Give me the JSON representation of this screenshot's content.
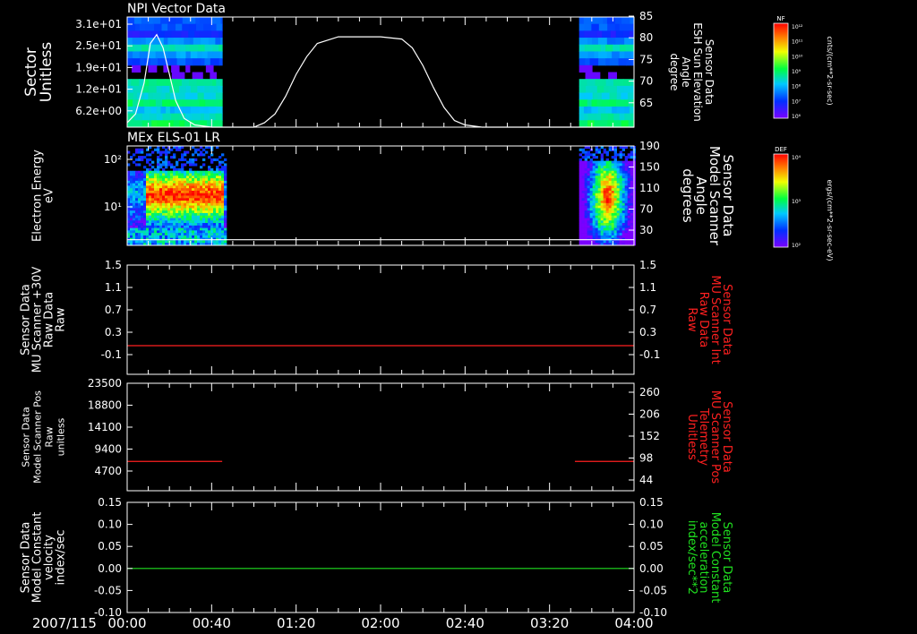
{
  "date_label": "2007/115",
  "time_ticks": [
    "00:00",
    "00:40",
    "01:20",
    "02:00",
    "02:40",
    "03:20",
    "04:00"
  ],
  "colorbars": [
    {
      "title": "NF",
      "unit": "cnts/(cm**2-sr-sec)",
      "ticks": [
        "10¹²",
        "10¹¹",
        "10¹⁰",
        "10⁹",
        "10⁸",
        "10⁷",
        "10⁶"
      ]
    },
    {
      "title": "DEF",
      "unit": "ergs/(cm**2-sr-sec-eV)",
      "ticks": [
        "10⁴",
        "10³",
        "10²"
      ]
    }
  ],
  "chart_data": [
    {
      "type": "heatmap",
      "title": "NPI Vector Data",
      "ylabel": [
        "Sector",
        "Unitless"
      ],
      "y_ticks": [
        "3.1e+01",
        "2.5e+01",
        "1.9e+01",
        "1.2e+01",
        "6.2e+00"
      ],
      "x_range": [
        "00:00",
        "04:00"
      ],
      "data_intervals": [
        [
          "00:00",
          "00:45"
        ],
        [
          "03:34",
          "04:00"
        ]
      ],
      "right_axis": {
        "label": [
          "Sensor Data",
          "ESH Sun Elevation",
          "Angle",
          "degree"
        ],
        "ticks": [
          85,
          80,
          75,
          70,
          65
        ],
        "ylim": [
          60,
          85
        ],
        "color": "#ffffff"
      },
      "overlay_line": {
        "name": "ESH Sun Elevation Angle",
        "x": [
          "00:00",
          "00:04",
          "00:08",
          "00:11",
          "00:14",
          "00:17",
          "00:20",
          "00:23",
          "00:27",
          "00:32",
          "00:40",
          "01:00",
          "01:05",
          "01:10",
          "01:15",
          "01:20",
          "01:25",
          "01:30",
          "01:40",
          "01:50",
          "02:00",
          "02:10",
          "02:15",
          "02:20",
          "02:25",
          "02:30",
          "02:35",
          "02:40",
          "02:48",
          "04:00"
        ],
        "y": [
          61,
          63,
          70,
          79,
          81,
          78,
          72,
          66,
          62,
          60.5,
          60,
          60,
          61,
          63,
          67,
          72,
          76,
          79,
          80.5,
          80.5,
          80.5,
          80,
          78,
          74,
          69,
          64.5,
          61.5,
          60.5,
          60,
          60
        ]
      }
    },
    {
      "type": "heatmap",
      "title": "MEx ELS-01 LR",
      "ylabel": [
        "Electron Energy",
        "eV"
      ],
      "y_ticks": [
        "10²",
        "10¹"
      ],
      "yscale": "log",
      "x_range": [
        "00:00",
        "04:00"
      ],
      "data_intervals": [
        [
          "00:00",
          "00:46"
        ],
        [
          "03:34",
          "04:00"
        ]
      ],
      "right_axis": {
        "label": [
          "Sensor Data",
          "Model Scanner",
          "Angle",
          "degrees"
        ],
        "ticks": [
          190,
          150,
          110,
          70,
          30
        ],
        "ylim": [
          0,
          190
        ],
        "color": "#ffffff"
      },
      "overlay_line": {
        "name": "Model Scanner Angle",
        "y": 4
      }
    },
    {
      "type": "line",
      "ylabel": [
        "Sensor Data",
        "MU Scanner +30V",
        "Raw Data",
        "Raw"
      ],
      "ylim": [
        -0.3,
        1.5
      ],
      "y_ticks": [
        1.5,
        1.1,
        0.7,
        0.3,
        -0.1
      ],
      "right_axis": {
        "label": [
          "Sensor Data",
          "MU Scanner Int",
          "Raw Data",
          "Raw"
        ],
        "ticks": [
          1.5,
          1.1,
          0.7,
          0.3,
          -0.1
        ],
        "ylim": [
          -0.3,
          1.5
        ],
        "color": "#ff2020"
      },
      "series": [
        {
          "x": [
            "00:00",
            "04:00"
          ],
          "y": [
            0.05,
            0.05
          ],
          "color": "#ff2020",
          "axis": "right"
        }
      ]
    },
    {
      "type": "line",
      "ylabel": [
        "Sensor Data",
        "Model Scanner Pos",
        "Raw",
        "unitless"
      ],
      "ylim": [
        0,
        23500
      ],
      "y_ticks": [
        23500,
        18800,
        14100,
        9400,
        4700
      ],
      "right_axis": {
        "label": [
          "Sensor Data",
          "MU Scanner Pos",
          "Telemetry",
          "Unitless"
        ],
        "ticks": [
          260,
          206,
          152,
          98,
          44
        ],
        "ylim": [
          0,
          260
        ],
        "color": "#ff2020"
      },
      "series": [
        {
          "x": [
            "00:00",
            "00:45"
          ],
          "y": [
            84,
            84
          ],
          "color": "#ff2020",
          "axis": "right"
        },
        {
          "x": [
            "03:32",
            "04:00"
          ],
          "y": [
            84,
            84
          ],
          "color": "#ff2020",
          "axis": "right"
        }
      ]
    },
    {
      "type": "line",
      "ylabel": [
        "Sensor Data",
        "Model Constant",
        "velocity",
        "index/sec"
      ],
      "ylim": [
        -0.1,
        0.15
      ],
      "y_ticks": [
        "0.15",
        "0.10",
        "0.05",
        "0.00",
        "-0.05",
        "-0.10"
      ],
      "right_axis": {
        "label": [
          "Sensor Data",
          "Model Constant",
          "acceleration",
          "index/sec**2"
        ],
        "ticks": [
          "0.15",
          "0.10",
          "0.05",
          "0.00",
          "-0.05",
          "-0.10"
        ],
        "ylim": [
          -0.1,
          0.15
        ],
        "color": "#20e020"
      },
      "series": [
        {
          "x": [
            "00:00",
            "04:00"
          ],
          "y": [
            0,
            0
          ],
          "color": "#20e020",
          "axis": "right"
        }
      ]
    }
  ]
}
